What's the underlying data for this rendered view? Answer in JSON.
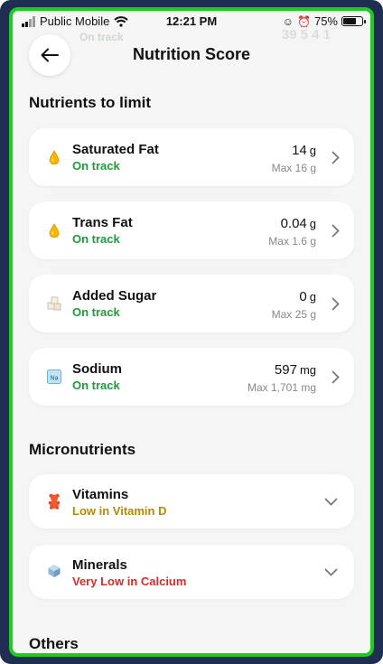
{
  "status_bar": {
    "carrier": "Public Mobile",
    "time": "12:21 PM",
    "battery": "75%",
    "battery_level": 0.75
  },
  "background_ghost": {
    "left_text": "On track",
    "right_text": "39 5 4 1"
  },
  "header": {
    "title": "Nutrition Score"
  },
  "limit_section": {
    "title": "Nutrients to limit",
    "items": [
      {
        "icon": "oil-drop-icon",
        "name": "Saturated Fat",
        "status": "On track",
        "value": "14",
        "unit": "g",
        "max": "Max 16 g"
      },
      {
        "icon": "oil-drop-icon",
        "name": "Trans Fat",
        "status": "On track",
        "value": "0.04",
        "unit": "g",
        "max": "Max 1.6 g"
      },
      {
        "icon": "sugar-cubes-icon",
        "name": "Added Sugar",
        "status": "On track",
        "value": "0",
        "unit": "g",
        "max": "Max 25 g"
      },
      {
        "icon": "salt-na-icon",
        "name": "Sodium",
        "status": "On track",
        "value": "597",
        "unit": "mg",
        "max": "Max 1,701 mg"
      }
    ]
  },
  "micro_section": {
    "title": "Micronutrients",
    "items": [
      {
        "icon": "gummy-bear-icon",
        "name": "Vitamins",
        "status": "Low in Vitamin D"
      },
      {
        "icon": "mineral-crystal-icon",
        "name": "Minerals",
        "status": "Very Low in Calcium"
      }
    ]
  },
  "others_section": {
    "title": "Others"
  },
  "colors": {
    "frame_border": "#1fcb1f",
    "frame_outer": "#1f2f52",
    "background": "#f5f5f5",
    "on_track": "#1e9a3b",
    "low": "#b58a00",
    "very_low": "#d42c2c"
  }
}
